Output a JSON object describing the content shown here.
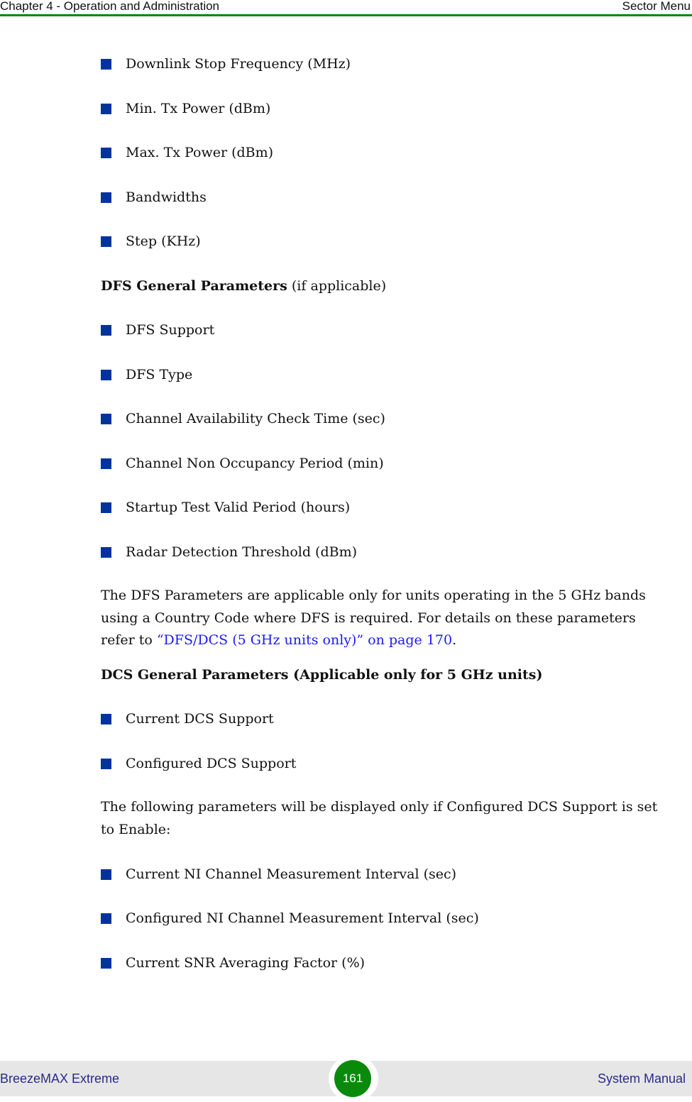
{
  "header": {
    "chapter": "Chapter 4 - Operation and Administration",
    "section": "Sector Menu",
    "rule_color": "#0a8a0a"
  },
  "list1": [
    "Downlink Stop Frequency (MHz)",
    "Min. Tx Power (dBm)",
    "Max. Tx Power (dBm)",
    "Bandwidths",
    "Step (KHz)"
  ],
  "dfs_heading": {
    "bold": "DFS General Parameters",
    "normal": " (if applicable)"
  },
  "list2": [
    "DFS Support",
    "DFS Type",
    "Channel Availability Check Time (sec)",
    "Channel Non Occupancy Period (min)",
    "Startup Test Valid Period (hours)",
    "Radar Detection Threshold (dBm)"
  ],
  "dfs_note": {
    "line1": "The DFS Parameters are applicable only for units operating in the 5 GHz bands",
    "line2": "using a Country Code where DFS is required. For details on these parameters",
    "line3_prefix": "refer to ",
    "link": "“DFS/DCS (5 GHz units only)” on page 170",
    "line3_suffix": "."
  },
  "dcs_heading": "DCS General Parameters (Applicable only for 5 GHz units)",
  "list3": [
    "Current DCS Support",
    "Configured DCS Support"
  ],
  "dcs_note": {
    "line1": "The following parameters will be displayed only if Configured DCS Support is set",
    "line2": "to Enable:"
  },
  "list4": [
    "Current NI Channel Measurement Interval (sec)",
    "Configured NI Channel Measurement Interval (sec)",
    "Current SNR Averaging Factor (%)"
  ],
  "footer": {
    "product": "BreezeMAX Extreme",
    "page_number": "161",
    "doc_type": "System Manual"
  },
  "colors": {
    "bullet": "#0033a0",
    "link": "#1a1aff",
    "accent_green": "#0a8a0a"
  }
}
